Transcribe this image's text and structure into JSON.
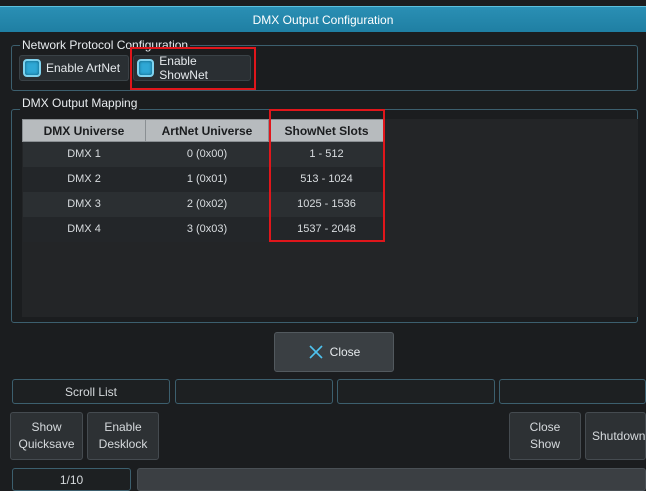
{
  "window": {
    "title": "DMX Output Configuration"
  },
  "network": {
    "label": "Network Protocol Configuration",
    "enable_artnet": "Enable ArtNet",
    "enable_shownet": "Enable ShowNet"
  },
  "mapping": {
    "label": "DMX Output Mapping",
    "columns": [
      "DMX Universe",
      "ArtNet Universe",
      "ShowNet Slots"
    ],
    "rows": [
      [
        "DMX 1",
        "0 (0x00)",
        "1 - 512"
      ],
      [
        "DMX 2",
        "1 (0x01)",
        "513 - 1024"
      ],
      [
        "DMX 3",
        "2 (0x02)",
        "1025 - 1536"
      ],
      [
        "DMX 4",
        "3 (0x03)",
        "1537 - 2048"
      ]
    ]
  },
  "close_label": "Close",
  "bottom": {
    "scroll_list": "Scroll List",
    "show_quicksave": "Show Quicksave",
    "enable_desklock": "Enable Desklock",
    "close_show": "Close Show",
    "shutdown": "Shutdown",
    "page": "1/10"
  },
  "colors": {
    "accent": "#2fa8d5",
    "highlight": "#e0161b"
  }
}
